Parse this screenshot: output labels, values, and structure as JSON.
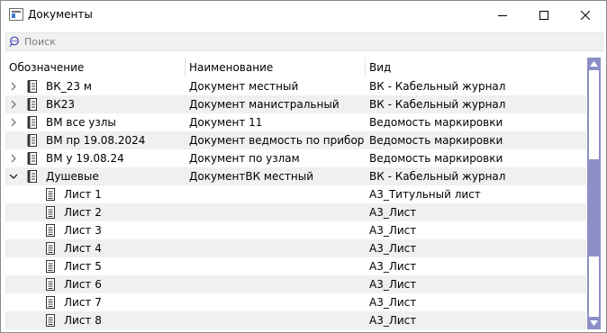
{
  "window": {
    "title": "Документы"
  },
  "search": {
    "placeholder": "Поиск",
    "value": ""
  },
  "columns": [
    {
      "label": "Обозначение"
    },
    {
      "label": "Наименование"
    },
    {
      "label": "Вид"
    }
  ],
  "rows": [
    {
      "designation": "ВК_23 м",
      "name": "Документ местный",
      "kind": "ВК - Кабельный журнал",
      "expander": "collapsed",
      "indent": 0
    },
    {
      "designation": "ВК23",
      "name": "Документ манистральный",
      "kind": "ВК - Кабельный журнал",
      "expander": "collapsed",
      "indent": 0
    },
    {
      "designation": "ВМ все узлы",
      "name": "Документ 11",
      "kind": "Ведомость маркировки",
      "expander": "collapsed",
      "indent": 0
    },
    {
      "designation": "ВМ пр 19.08.2024",
      "name": "Документ ведмость по приборам",
      "kind": "Ведомость маркировки",
      "expander": "none",
      "indent": 0
    },
    {
      "designation": "ВМ у 19.08.24",
      "name": "Документ по узлам",
      "kind": "Ведомость маркировки",
      "expander": "collapsed",
      "indent": 0
    },
    {
      "designation": "Душевые",
      "name": "ДокументВК местный",
      "kind": "ВК - Кабельный журнал",
      "expander": "expanded",
      "indent": 0
    },
    {
      "designation": "Лист 1",
      "name": "",
      "kind": "А3_Титульный лист",
      "expander": "none",
      "indent": 1
    },
    {
      "designation": "Лист 2",
      "name": "",
      "kind": "А3_Лист",
      "expander": "none",
      "indent": 1
    },
    {
      "designation": "Лист 3",
      "name": "",
      "kind": "А3_Лист",
      "expander": "none",
      "indent": 1
    },
    {
      "designation": "Лист 4",
      "name": "",
      "kind": "А3_Лист",
      "expander": "none",
      "indent": 1
    },
    {
      "designation": "Лист 5",
      "name": "",
      "kind": "А3_Лист",
      "expander": "none",
      "indent": 1
    },
    {
      "designation": "Лист 6",
      "name": "",
      "kind": "А3_Лист",
      "expander": "none",
      "indent": 1
    },
    {
      "designation": "Лист 7",
      "name": "",
      "kind": "А3_Лист",
      "expander": "none",
      "indent": 1
    },
    {
      "designation": "Лист 8",
      "name": "",
      "kind": "А3_Лист",
      "expander": "none",
      "indent": 1
    }
  ],
  "colors": {
    "scrollbar": "#8c8fc6",
    "alt_row": "#f0f0f0"
  }
}
